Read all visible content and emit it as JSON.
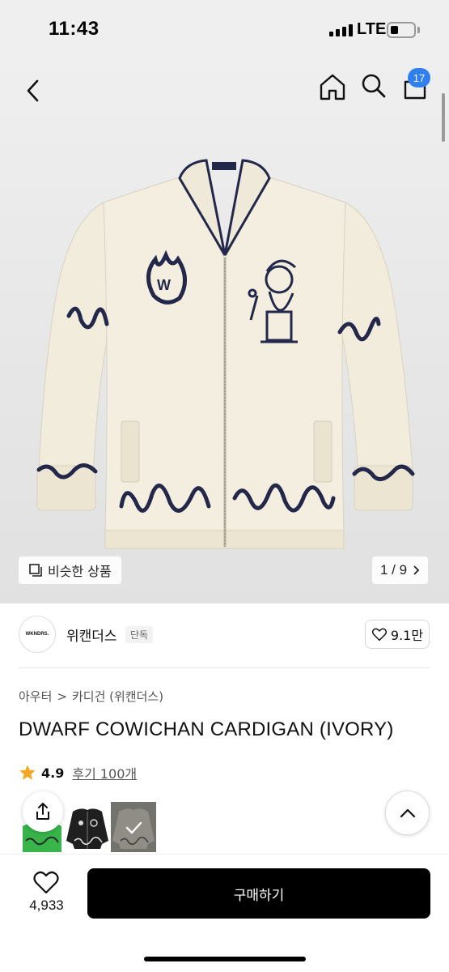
{
  "status_bar": {
    "time": "11:43",
    "network": "LTE"
  },
  "nav": {
    "cart_count": "17"
  },
  "gallery": {
    "similar_label": "비슷한 상품",
    "counter": "1 / 9"
  },
  "brand": {
    "logo_text": "WKNDRS.",
    "name": "위캔더스",
    "badge": "단독",
    "likes": "9.1만"
  },
  "breadcrumb": {
    "category": "아우터",
    "separator": ">",
    "subcategory": "카디건 (위캔더스)"
  },
  "product": {
    "title": "DWARF COWICHAN CARDIGAN (IVORY)",
    "rating": "4.9",
    "reviews": "후기 100개"
  },
  "bottom": {
    "wish_count": "4,933",
    "buy_label": "구매하기"
  },
  "colors": {
    "badge_blue": "#2f80ed",
    "star": "#f5a623",
    "cardigan_ivory": "#f1ecdc",
    "pattern_navy": "#23284a"
  },
  "icons": [
    "back-icon",
    "home-icon",
    "search-icon",
    "shopping-bag-icon",
    "similar-icon",
    "chevron-right-icon",
    "heart-icon",
    "star-icon",
    "share-icon",
    "chevron-up-icon",
    "checkmark-icon"
  ]
}
